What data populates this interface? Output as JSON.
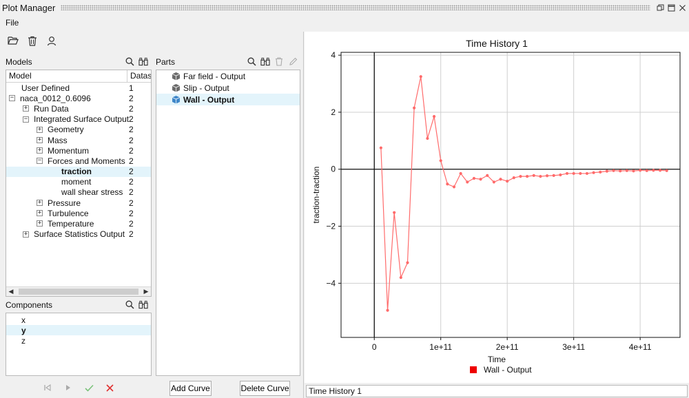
{
  "window": {
    "title": "Plot Manager"
  },
  "menu": {
    "file": "File"
  },
  "models": {
    "label": "Models",
    "columns": [
      "Model",
      "Datas"
    ],
    "rows": [
      {
        "label": "User Defined",
        "count": "1",
        "level": 0,
        "toggle": ""
      },
      {
        "label": "naca_0012_0.6096",
        "count": "2",
        "level": 0,
        "toggle": "-"
      },
      {
        "label": "Run Data",
        "count": "2",
        "level": 1,
        "toggle": "+"
      },
      {
        "label": "Integrated Surface Output",
        "count": "2",
        "level": 1,
        "toggle": "-"
      },
      {
        "label": "Geometry",
        "count": "2",
        "level": 2,
        "toggle": "+"
      },
      {
        "label": "Mass",
        "count": "2",
        "level": 2,
        "toggle": "+"
      },
      {
        "label": "Momentum",
        "count": "2",
        "level": 2,
        "toggle": "+"
      },
      {
        "label": "Forces and Moments",
        "count": "2",
        "level": 2,
        "toggle": "-"
      },
      {
        "label": "traction",
        "count": "2",
        "level": 3,
        "toggle": "",
        "selected": true
      },
      {
        "label": "moment",
        "count": "2",
        "level": 3,
        "toggle": ""
      },
      {
        "label": "wall shear stress",
        "count": "2",
        "level": 3,
        "toggle": ""
      },
      {
        "label": "Pressure",
        "count": "2",
        "level": 2,
        "toggle": "+"
      },
      {
        "label": "Turbulence",
        "count": "2",
        "level": 2,
        "toggle": "+"
      },
      {
        "label": "Temperature",
        "count": "2",
        "level": 2,
        "toggle": "+"
      },
      {
        "label": "Surface Statistics Output",
        "count": "2",
        "level": 1,
        "toggle": "+"
      }
    ]
  },
  "components": {
    "label": "Components",
    "items": [
      {
        "label": "x"
      },
      {
        "label": "y",
        "selected": true
      },
      {
        "label": "z"
      }
    ]
  },
  "parts": {
    "label": "Parts",
    "items": [
      {
        "label": "Far field - Output"
      },
      {
        "label": "Slip - Output"
      },
      {
        "label": "Wall - Output",
        "selected": true
      }
    ],
    "add_curve": "Add Curve",
    "delete_curve": "Delete Curve"
  },
  "status_field": {
    "value": "Time History 1"
  },
  "chart_data": {
    "type": "line",
    "title": "Time History 1",
    "xlabel": "Time",
    "ylabel": "traction-traction",
    "xlim": [
      -50000000000.0,
      460000000000.0
    ],
    "ylim": [
      -5.9,
      4.1
    ],
    "xticks": [
      0,
      100000000000.0,
      200000000000.0,
      300000000000.0,
      400000000000.0
    ],
    "xtick_labels": [
      "0",
      "1e+11",
      "2e+11",
      "3e+11",
      "4e+11"
    ],
    "yticks": [
      -4,
      -2,
      0,
      2,
      4
    ],
    "ytick_labels": [
      "−4",
      "−2",
      "0",
      "2",
      "4"
    ],
    "grid": true,
    "legend_position": "bottom",
    "series": [
      {
        "name": "Wall - Output",
        "color": "#ff6b6b",
        "legend_color": "#ee0000",
        "x": [
          10000000000.0,
          20000000000.0,
          30000000000.0,
          40000000000.0,
          50000000000.0,
          60000000000.0,
          70000000000.0,
          80000000000.0,
          90000000000.0,
          100000000000.0,
          110000000000.0,
          120000000000.0,
          130000000000.0,
          140000000000.0,
          150000000000.0,
          160000000000.0,
          170000000000.0,
          180000000000.0,
          190000000000.0,
          200000000000.0,
          210000000000.0,
          220000000000.0,
          230000000000.0,
          240000000000.0,
          250000000000.0,
          260000000000.0,
          270000000000.0,
          280000000000.0,
          290000000000.0,
          300000000000.0,
          310000000000.0,
          320000000000.0,
          330000000000.0,
          340000000000.0,
          350000000000.0,
          360000000000.0,
          370000000000.0,
          380000000000.0,
          390000000000.0,
          400000000000.0,
          410000000000.0,
          420000000000.0,
          430000000000.0,
          440000000000.0
        ],
        "y": [
          0.75,
          -4.95,
          -1.52,
          -3.8,
          -3.28,
          2.15,
          3.25,
          1.08,
          1.85,
          0.3,
          -0.52,
          -0.62,
          -0.15,
          -0.45,
          -0.32,
          -0.35,
          -0.22,
          -0.45,
          -0.35,
          -0.42,
          -0.3,
          -0.25,
          -0.25,
          -0.22,
          -0.25,
          -0.23,
          -0.22,
          -0.2,
          -0.15,
          -0.15,
          -0.15,
          -0.15,
          -0.12,
          -0.1,
          -0.07,
          -0.05,
          -0.06,
          -0.05,
          -0.06,
          -0.04,
          -0.05,
          -0.04,
          -0.04,
          -0.05
        ]
      }
    ]
  }
}
